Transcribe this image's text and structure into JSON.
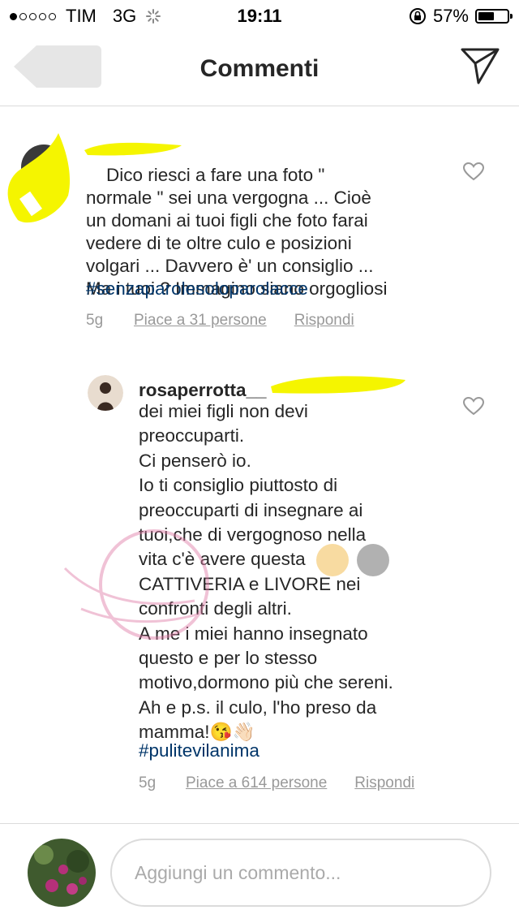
{
  "status_bar": {
    "carrier": "TIM",
    "network": "3G",
    "time": "19:11",
    "battery": "57%",
    "battery_level": 0.57,
    "signal_bars_filled": 1,
    "signal_bars_total": 5
  },
  "header": {
    "title": "Commenti"
  },
  "comments": [
    {
      "text": "Dico riesci a fare una foto \"\nnormale \" sei una vergogna ... Cioè\nun domani ai tuoi figli che foto farai\nvedere di te oltre culo e posizioni\nvolgari ... Davvero è' un consiglio ...\nMa i tuoi ? Immagino siano orgogliosi",
      "hashtag": "#senzaparolesoloparolacce",
      "age": "5g",
      "likes": "Piace a 31 persone",
      "reply": "Rispondi"
    },
    {
      "username": "rosaperrotta__",
      "text": "dei miei figli non devi\npreoccuparti.\nCi penserò io.\nIo ti consiglio piuttosto di\npreoccuparti di insegnare ai\ntuoi,che di vergognoso nella\nvita c'è avere questa\nCATTIVERIA e LIVORE nei\nconfronti degli altri.\nA me i miei hanno insegnato\nquesto e per lo stesso\nmotivo,dormono più che sereni.\nAh e p.s. il culo, l'ho preso da\nmamma!😘👋🏻",
      "hashtag": "#pulitevilanima",
      "age": "5g",
      "likes": "Piace a 614 persone",
      "reply": "Rispondi"
    }
  ],
  "composer": {
    "placeholder": "Aggiungi un commento..."
  },
  "colors": {
    "hashtag": "#003569",
    "meta": "#999999",
    "divider": "#dbdbdb",
    "highlighter": "#f5f500"
  }
}
